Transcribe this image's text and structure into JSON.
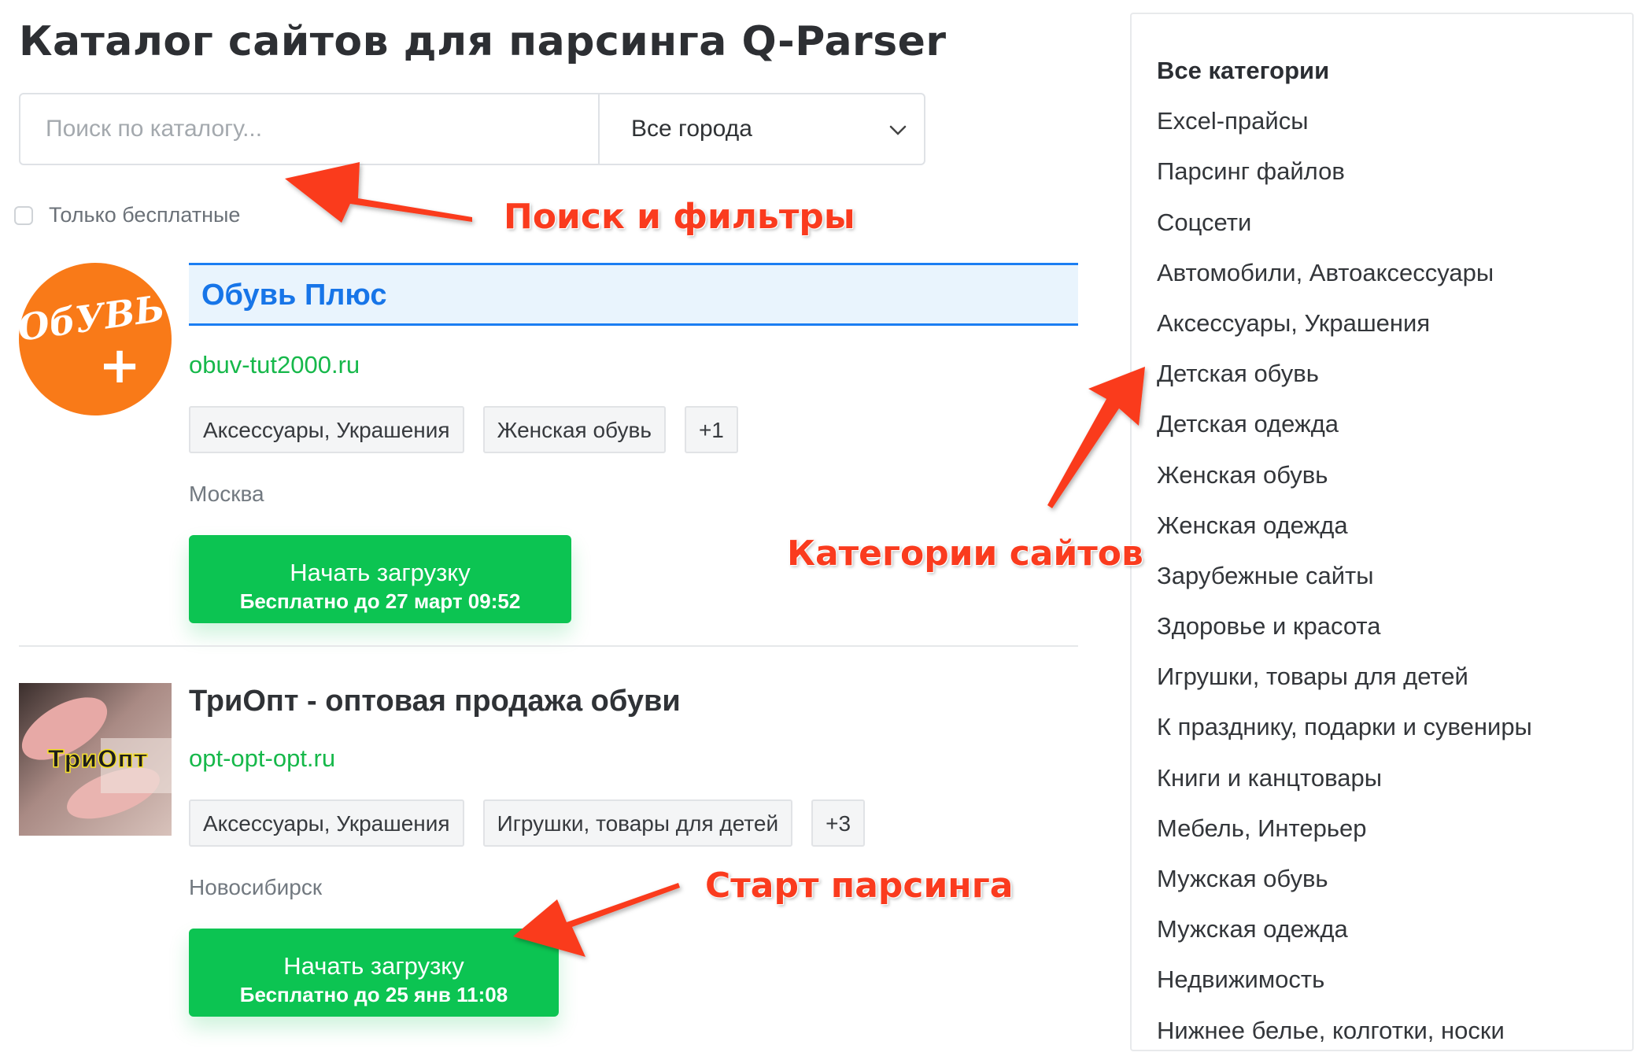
{
  "page": {
    "title": "Каталог сайтов для парсинга Q-Parser"
  },
  "search": {
    "placeholder": "Поиск по каталогу...",
    "city_selected": "Все города",
    "free_only_label": "Только бесплатные",
    "free_only_checked": false
  },
  "sites": [
    {
      "title": "Обувь Плюс",
      "logo_text": "ОбУВЬ",
      "logo_plus": "+",
      "logo_color": "#f97a18",
      "url": "obuv-tut2000.ru",
      "tags": [
        "Аксессуары, Украшения",
        "Женская обувь",
        "+1"
      ],
      "city": "Москва",
      "button_label": "Начать загрузку",
      "button_sub": "Бесплатно до 27 март 09:52"
    },
    {
      "title": "ТриОпт - оптовая продажа обуви",
      "logo_text": "ТриОпт",
      "url": "opt-opt-opt.ru",
      "tags": [
        "Аксессуары, Украшения",
        "Игрушки, товары для детей",
        "+3"
      ],
      "city": "Новосибирск",
      "button_label": "Начать загрузку",
      "button_sub": "Бесплатно до 25 янв 11:08"
    }
  ],
  "categories": {
    "items": [
      "Все категории",
      "Excel-прайсы",
      "Парсинг файлов",
      "Соцсети",
      "Автомобили, Автоаксессуары",
      "Аксессуары, Украшения",
      "Детская обувь",
      "Детская одежда",
      "Женская обувь",
      "Женская одежда",
      "Зарубежные сайты",
      "Здоровье и красота",
      "Игрушки, товары для детей",
      "К празднику, подарки и сувениры",
      "Книги и канцтовары",
      "Мебель, Интерьер",
      "Мужская обувь",
      "Мужская одежда",
      "Недвижимость",
      "Нижнее белье, колготки, носки"
    ],
    "active_index": 0
  },
  "annotations": {
    "search_filters": "Поиск и фильтры",
    "site_categories": "Категории сайтов",
    "start_parsing": "Старт парсинга"
  },
  "colors": {
    "accent_green": "#0cc452",
    "link_green": "#16b84a",
    "highlight_blue": "#1b7ef2",
    "annotation_red": "#fa3b1e"
  }
}
